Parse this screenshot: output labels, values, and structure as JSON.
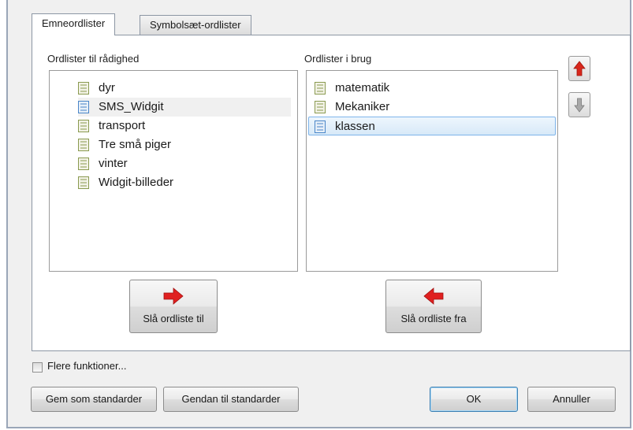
{
  "tabs": [
    {
      "label": "Emneordlister",
      "active": true
    },
    {
      "label": "Symbolsæt-ordlister",
      "active": false
    }
  ],
  "available_lists": {
    "label": "Ordlister til rådighed",
    "items": [
      {
        "label": "dyr"
      },
      {
        "label": "SMS_Widgit",
        "state": "hover"
      },
      {
        "label": "transport"
      },
      {
        "label": "Tre små piger"
      },
      {
        "label": "vinter"
      },
      {
        "label": "Widgit-billeder"
      }
    ]
  },
  "in_use_lists": {
    "label": "Ordlister i brug",
    "items": [
      {
        "label": "matematik"
      },
      {
        "label": "Mekaniker"
      },
      {
        "label": "klassen",
        "state": "selected"
      }
    ]
  },
  "actions": {
    "enable_label": "Slå ordliste til",
    "disable_label": "Slå ordliste fra"
  },
  "options": {
    "more_functions_label": "Flere funktioner...",
    "more_functions_checked": false
  },
  "footer": {
    "save_defaults_label": "Gem som standarder",
    "restore_defaults_label": "Gendan til standarder",
    "ok_label": "OK",
    "cancel_label": "Annuller"
  },
  "colors": {
    "arrow_red": "#e02020",
    "move_up_red": "#d8271c",
    "move_down_gray": "#9a9a9a",
    "selection_border": "#7eb4ea",
    "list_icon_blue": "#4a86c8",
    "list_icon_olive": "#8a9a50"
  },
  "icons": {
    "move_up": "up-arrow-icon",
    "move_down": "down-arrow-icon",
    "add": "right-arrow-icon",
    "remove": "left-arrow-icon",
    "list_item": "word-list-icon"
  }
}
